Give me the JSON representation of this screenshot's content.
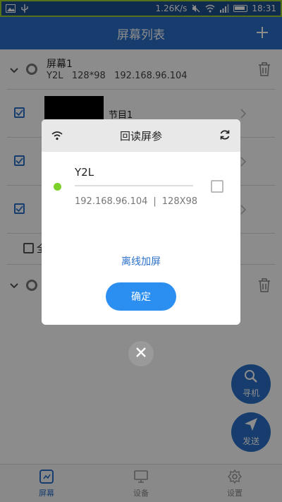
{
  "status_bar": {
    "speed": "1.26K/s",
    "time": "18:31",
    "icons": [
      "image-icon",
      "usb-icon",
      "mute-icon",
      "wifi-icon",
      "signal-icon",
      "battery-icon"
    ]
  },
  "header": {
    "title": "屏幕列表",
    "add_icon": "plus-icon"
  },
  "screens": [
    {
      "name": "屏幕1",
      "model": "Y2L",
      "resolution": "128*98",
      "ip": "192.168.96.104",
      "programs": [
        {
          "name": "节目1",
          "checked": true
        },
        {
          "name": "",
          "checked": true
        },
        {
          "name": "",
          "checked": true
        }
      ],
      "select_all_label": "全"
    },
    {
      "name": "",
      "model": "",
      "resolution": "",
      "ip": ""
    }
  ],
  "dialog": {
    "title": "回读屏参",
    "device": {
      "name": "Y2L",
      "ip": "192.168.96.104",
      "separator": "|",
      "size": "128X98",
      "status_color": "#7cd12a"
    },
    "offline_link": "离线加屏",
    "confirm_label": "确定"
  },
  "fabs": [
    {
      "label": "寻机",
      "icon": "search-icon"
    },
    {
      "label": "发送",
      "icon": "send-icon"
    }
  ],
  "bottom_nav": [
    {
      "label": "屏幕",
      "icon": "screen-icon",
      "active": true
    },
    {
      "label": "设备",
      "icon": "monitor-icon",
      "active": false
    },
    {
      "label": "设置",
      "icon": "gear-icon",
      "active": false
    }
  ],
  "colors": {
    "primary": "#2a6fc9",
    "confirm": "#2a8ff0",
    "online": "#7cd12a"
  }
}
